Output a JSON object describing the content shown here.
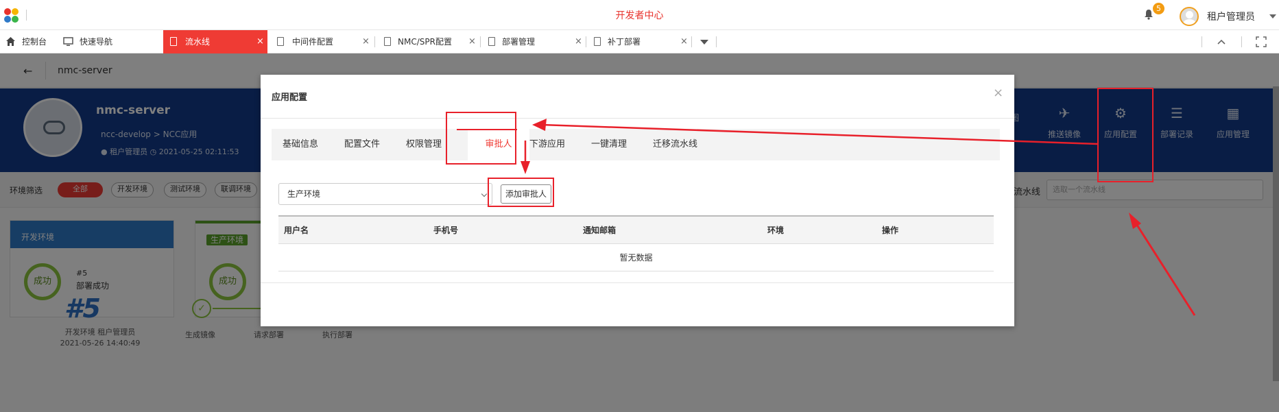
{
  "header": {
    "app_title": "开发者中心",
    "notification_count": "5",
    "user_name": "租户管理员"
  },
  "tabs": [
    {
      "label": "控制台",
      "icon": "home-icon"
    },
    {
      "label": "快速导航",
      "icon": "monitor-icon"
    },
    {
      "label": "流水线",
      "icon": "document-icon",
      "active": true
    },
    {
      "label": "中间件配置",
      "icon": "document-icon"
    },
    {
      "label": "NMC/SPR配置",
      "icon": "document-icon"
    },
    {
      "label": "部署管理",
      "icon": "document-icon"
    },
    {
      "label": "补丁部署",
      "icon": "document-icon"
    }
  ],
  "tab_close": "×",
  "page": {
    "back_glyph": "←",
    "subhead_title": "nmc-server",
    "banner": {
      "title": "nmc-server",
      "crumb": "ncc-develop  >  NCC应用",
      "meta_user": "租户管理员",
      "meta_time": "2021-05-25 02:11:53",
      "actions": [
        {
          "label": "图",
          "glyph": ""
        },
        {
          "label": "推送镜像",
          "glyph": "✈"
        },
        {
          "label": "应用配置",
          "glyph": "⚙"
        },
        {
          "label": "部署记录",
          "glyph": "☰"
        },
        {
          "label": "应用管理",
          "glyph": "▦"
        }
      ]
    },
    "filter": {
      "label": "环境筛选",
      "pills": [
        "全部",
        "开发环境",
        "测试环境",
        "联调环境"
      ],
      "pipeline_label": "流水线",
      "pipeline_placeholder": "选取一个流水线"
    },
    "env_cards": [
      {
        "name": "开发环境",
        "status_ring": "成功",
        "num": "#5",
        "status": "部署成功",
        "color": "#2f7ac8"
      },
      {
        "name": "生产环境",
        "status_ring": "成功",
        "color": "#5ba32b"
      }
    ],
    "history": {
      "number": "#5",
      "meta_line1": "开发环境 租户管理员",
      "meta_line2": "2021-05-26 14:40:49",
      "steps": [
        "生成镜像",
        "请求部署",
        "执行部署"
      ]
    }
  },
  "modal": {
    "title": "应用配置",
    "close_glyph": "×",
    "tabs": [
      "基础信息",
      "配置文件",
      "权限管理",
      "审批人",
      "下游应用",
      "一键清理",
      "迁移流水线"
    ],
    "active_tab": 3,
    "env_select_value": "生产环境",
    "add_button": "添加审批人",
    "table_headers": [
      "用户名",
      "手机号",
      "通知邮箱",
      "环境",
      "操作"
    ],
    "empty_text": "暂无数据"
  },
  "colors": {
    "brand_red": "#ef3b34",
    "banner_blue": "#123a8a",
    "success_green": "#8dc63f",
    "annotation_red": "#e8202a"
  }
}
